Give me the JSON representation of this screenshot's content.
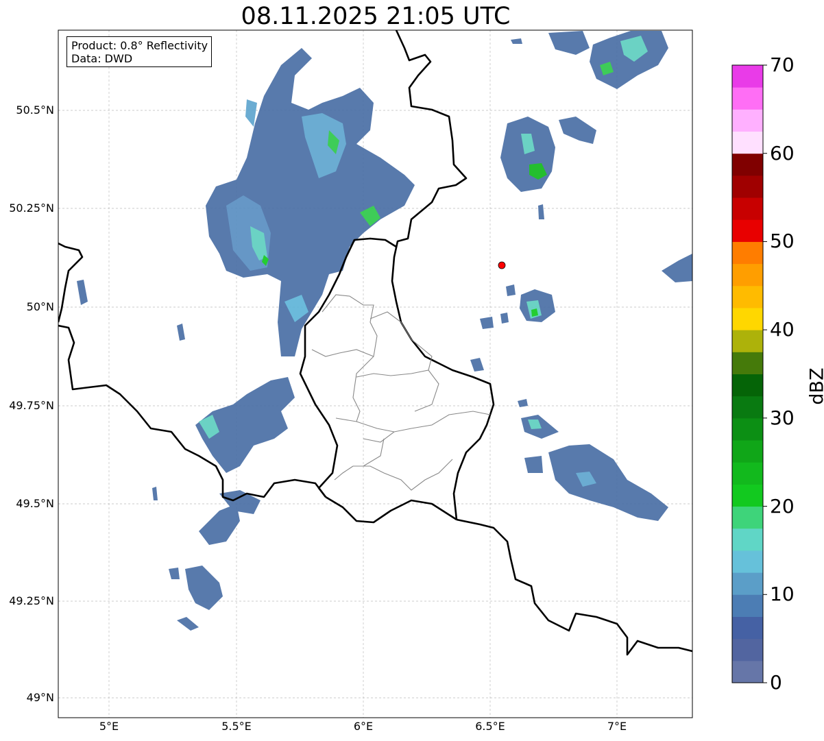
{
  "title": "08.11.2025 21:05 UTC",
  "info": {
    "product": "Product: 0.8° Reflectivity",
    "data": "Data: DWD"
  },
  "latitude_labels": [
    "50.5°N",
    "50.25°N",
    "50°N",
    "49.75°N",
    "49.5°N",
    "49.25°N",
    "49°N"
  ],
  "longitude_labels": [
    "5°E",
    "5.5°E",
    "6°E",
    "6.5°E",
    "7°E"
  ],
  "colorbar": {
    "label": "dBZ",
    "ticks": [
      "0",
      "10",
      "20",
      "30",
      "40",
      "50",
      "60",
      "70"
    ],
    "colors": [
      "#6676a8",
      "#5265a0",
      "#4561a4",
      "#4c7db4",
      "#5b9ec8",
      "#66c1da",
      "#60d6c6",
      "#3ed47a",
      "#12c91f",
      "#12b91d",
      "#10a618",
      "#0c8f14",
      "#097a11",
      "#056407",
      "#457a0a",
      "#adb20a",
      "#ffd700",
      "#ffbb00",
      "#ff9e00",
      "#ff7d00",
      "#e80000",
      "#c80000",
      "#a00000",
      "#800000",
      "#ffe0ff",
      "#ffb0ff",
      "#ff6ef5",
      "#e93be8"
    ]
  },
  "marker_color": "#ff0000",
  "precip_color_main": "#4a6fa5"
}
